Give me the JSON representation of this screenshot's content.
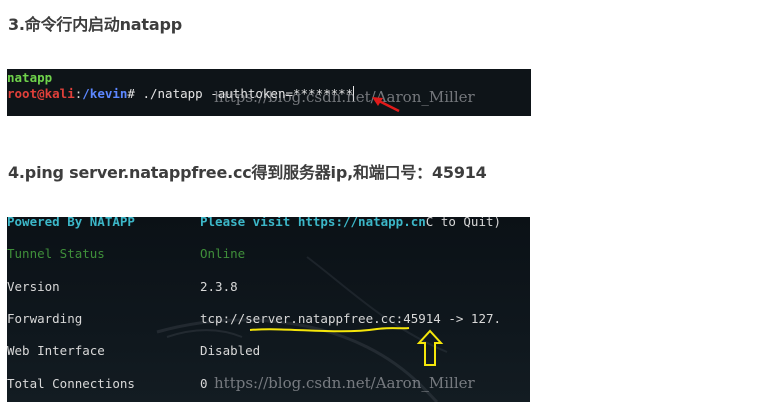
{
  "step3": {
    "heading": "3.命令行内启动natapp"
  },
  "terminal1": {
    "user_line": "natapp",
    "prompt_user": "root@kali",
    "prompt_sep": ":",
    "prompt_path": "/kevin",
    "prompt_end": "# ",
    "command": "./natapp -authtoken=********",
    "watermark": "https://blog.csdn.net/Aaron_Miller"
  },
  "step4": {
    "heading": "4.ping server.natappfree.cc得到服务器ip,和端口号：45914"
  },
  "terminal2": {
    "powered_by": "Powered By NATAPP",
    "visit_text": "Please visit https://natapp.cn",
    "visit_tail": "C to Quit)",
    "rows": [
      {
        "label": "Tunnel Status",
        "value": "Online"
      },
      {
        "label": "Version",
        "value": "2.3.8"
      },
      {
        "label": "Forwarding",
        "value_prefix": "tcp://",
        "host": "server.natappfree.cc",
        "port": ":45914",
        "value_suffix": " -> 127."
      },
      {
        "label": "Web Interface",
        "value": "Disabled"
      },
      {
        "label": "Total Connections",
        "value": "0"
      }
    ],
    "watermark": "https://blog.csdn.net/Aaron_Miller"
  },
  "colors": {
    "heading": "#3d3d3d",
    "terminal_bg": "#0e1418",
    "prompt_user": "#e0403a",
    "prompt_path": "#5c87ff",
    "natapp_cyan": "#3cb7c8",
    "status_green": "#3f8f3a",
    "annotation_yellow": "#f5e60a",
    "annotation_red": "#e11b1b"
  }
}
